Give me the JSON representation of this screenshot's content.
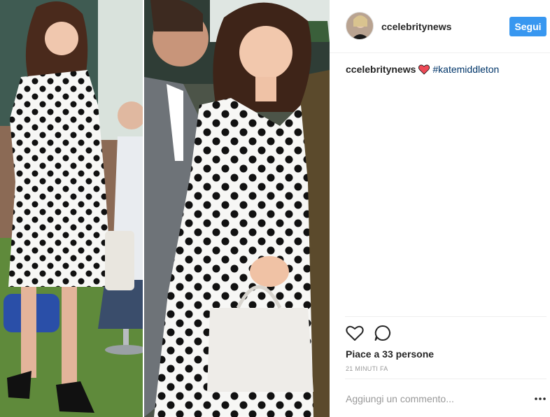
{
  "post": {
    "username": "ccelebritynews",
    "follow_label": "Segui",
    "caption": {
      "username": "ccelebritynews",
      "emoji": "heart-emoji",
      "hashtag": "#katemiddleton"
    },
    "likes_text": "Piace a 33 persone",
    "timestamp": "21 MINUTI FA",
    "comment_placeholder": "Aggiungi un commento...",
    "colors": {
      "follow_button": "#3897f0",
      "hashtag": "#003569",
      "heart": "#ed4956",
      "muted": "#999999"
    },
    "icons": [
      "like-heart-icon",
      "comment-bubble-icon",
      "more-options-icon"
    ]
  }
}
